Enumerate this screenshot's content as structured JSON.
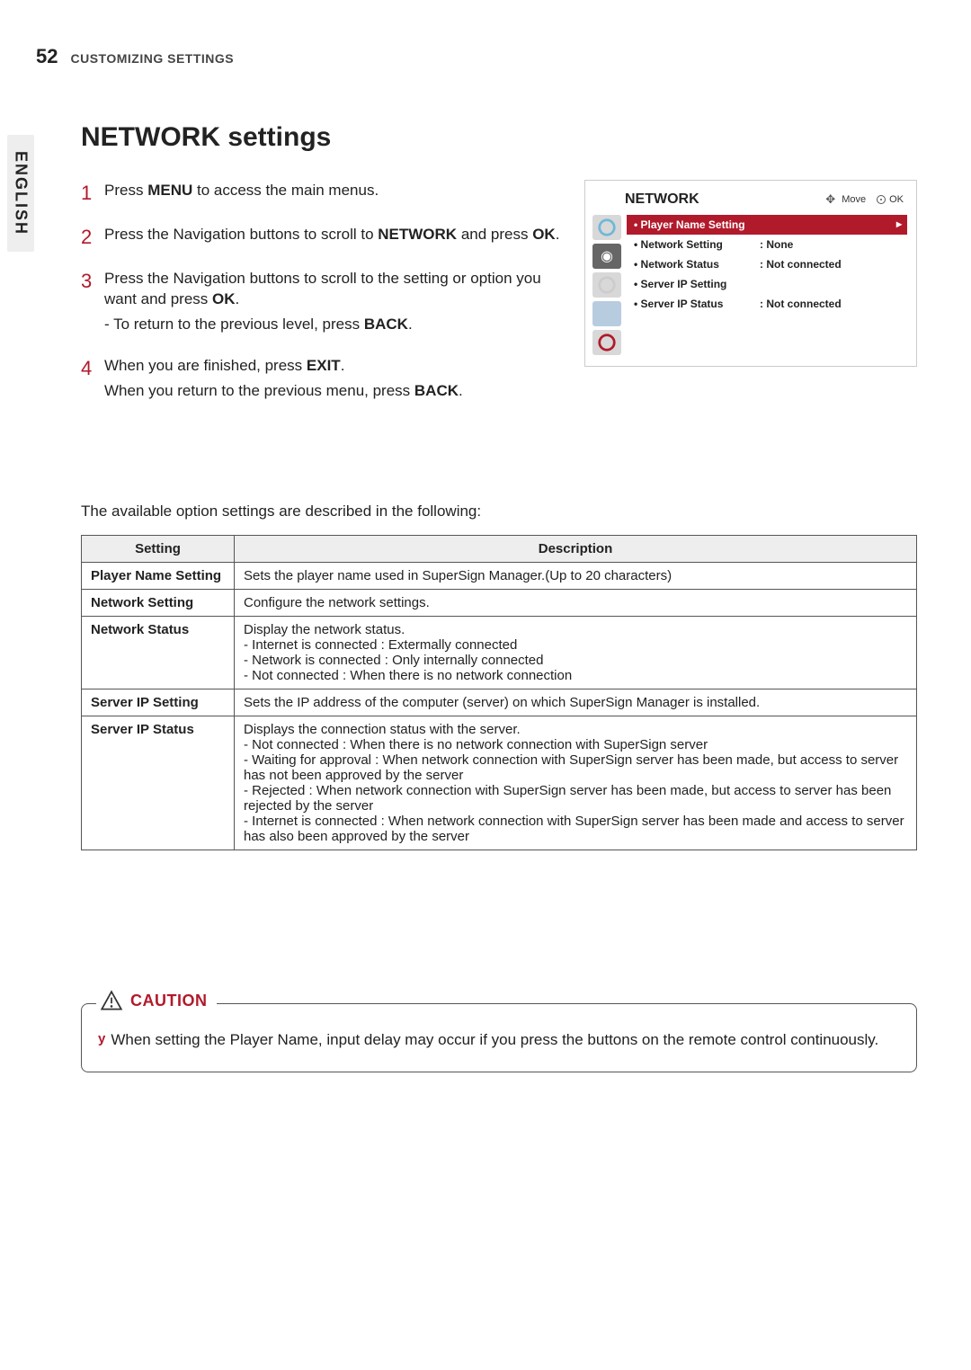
{
  "page": {
    "number": "52",
    "header": "CUSTOMIZING SETTINGS",
    "side_tab": "ENGLISH"
  },
  "section": {
    "title": "NETWORK settings"
  },
  "steps": {
    "s1": {
      "num": "1",
      "pre": "Press ",
      "bold": "MENU",
      "post": " to access the main menus."
    },
    "s2": {
      "num": "2",
      "pre": "Press the Navigation buttons to scroll to ",
      "bold1": "NETWORK",
      "mid": " and press ",
      "bold2": "OK",
      "post": "."
    },
    "s3": {
      "num": "3",
      "line_pre": "Press the Navigation buttons to scroll to the setting or option you want and press ",
      "line_bold": "OK",
      "line_post": ".",
      "sub_dash": "- To return to the previous level, press ",
      "sub_bold": "BACK",
      "sub_post": "."
    },
    "s4": {
      "num": "4",
      "l1_pre": "When you are finished, press ",
      "l1_bold": "EXIT",
      "l1_post": ".",
      "l2_pre": "When you return to the previous menu, press ",
      "l2_bold": "BACK",
      "l2_post": "."
    }
  },
  "osd": {
    "title": "NETWORK",
    "move": "Move",
    "ok": "OK",
    "items": [
      {
        "label": "• Player Name Setting",
        "value": ""
      },
      {
        "label": "• Network Setting",
        "value": ": None"
      },
      {
        "label": "• Network Status",
        "value": ": Not connected"
      },
      {
        "label": "• Server IP Setting",
        "value": ""
      },
      {
        "label": "• Server IP Status",
        "value": ": Not connected"
      }
    ]
  },
  "table_intro": "The available option settings are described in the following:",
  "table": {
    "h_setting": "Setting",
    "h_desc": "Description",
    "rows": [
      {
        "setting": "Player Name Setting",
        "desc": "Sets the player name used in SuperSign Manager.(Up to 20 characters)"
      },
      {
        "setting": "Network Setting",
        "desc": "Configure the network settings."
      },
      {
        "setting": "Network Status",
        "desc": "Display the network status.\n- Internet is connected : Extermally connected\n- Network is connected : Only internally connected\n- Not connected : When there is no network connection"
      },
      {
        "setting": "Server IP Setting",
        "desc": "Sets the IP address of the computer (server) on which SuperSign Manager is installed."
      },
      {
        "setting": "Server IP Status",
        "desc": "Displays the connection status with the server.\n- Not connected : When there is no network connection with SuperSign server\n- Waiting for approval : When network connection with SuperSign server has been made, but access to server has not been approved by the server\n- Rejected : When network connection with SuperSign server has been made, but access to server has been rejected by the server\n- Internet is connected : When network connection with SuperSign server has been made and access to server has also been approved by the server"
      }
    ]
  },
  "caution": {
    "heading": "CAUTION",
    "bullet": "y",
    "text": "When setting the Player Name, input delay may occur if you press the buttons on the remote control continuously."
  }
}
